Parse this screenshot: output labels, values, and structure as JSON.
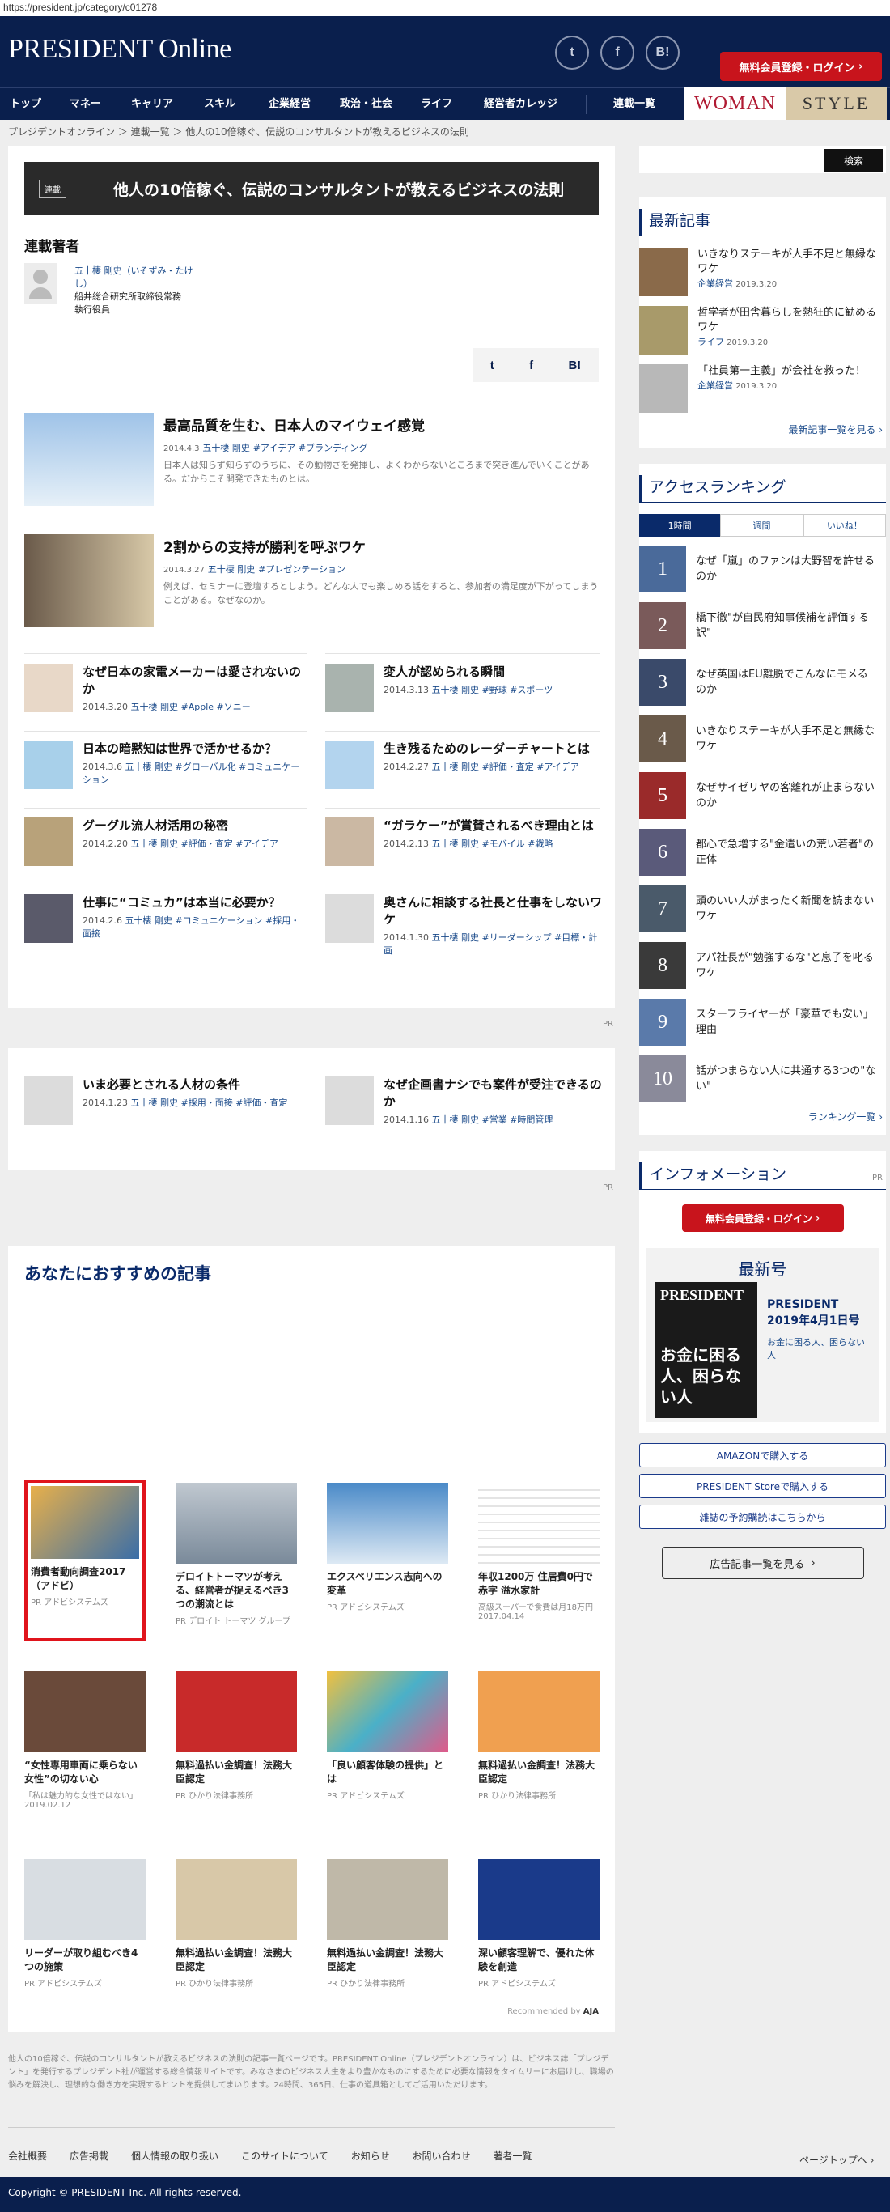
{
  "url": "https://president.jp/category/c01278",
  "logo": "PRESIDENT Online",
  "social": {
    "twitter": "t",
    "facebook": "f",
    "hatena": "B!"
  },
  "register": "無料会員登録・ログイン",
  "nav": [
    "トップ",
    "マネー",
    "キャリア",
    "スキル",
    "企業経営",
    "政治・社会",
    "ライフ",
    "経営者カレッジ",
    "連載一覧"
  ],
  "woman": "WOMAN",
  "style_label": "STYLE",
  "breadcrumb": [
    "プレジデントオンライン",
    "連載一覧",
    "他人の10倍稼ぐ、伝説のコンサルタントが教えるビジネスの法則"
  ],
  "series": {
    "tag": "連載",
    "title": "他人の10倍稼ぐ、伝説のコンサルタントが教えるビジネスの法則"
  },
  "author": {
    "heading": "連載著者",
    "name": "五十棲 剛史（いそずみ・たけし）",
    "org": "船井総合研究所取締役常務",
    "role": "執行役員"
  },
  "featured": [
    {
      "title": "最高品質を生む、日本人のマイウェイ感覚",
      "date": "2014.4.3",
      "author": "五十棲 剛史",
      "tags": "#アイデア #ブランディング",
      "excerpt": "日本人は知らず知らずのうちに、その動物さを発揮し、よくわからないところまで突き進んでいくことがある。だからこそ開発できたものとは。"
    },
    {
      "title": "2割からの支持が勝利を呼ぶワケ",
      "date": "2014.3.27",
      "author": "五十棲 剛史",
      "tags": "#プレゼンテーション",
      "excerpt": "例えば、セミナーに登壇するとしよう。どんな人でも楽しめる話をすると、参加者の満足度が下がってしまうことがある。なぜなのか。"
    }
  ],
  "grid": [
    {
      "title": "なぜ日本の家電メーカーは愛されないのか",
      "date": "2014.3.20",
      "author": "五十棲 剛史",
      "tags": "#Apple #ソニー"
    },
    {
      "title": "変人が認められる瞬間",
      "date": "2014.3.13",
      "author": "五十棲 剛史",
      "tags": "#野球 #スポーツ"
    },
    {
      "title": "日本の暗黙知は世界で活かせるか？",
      "date": "2014.3.6",
      "author": "五十棲 剛史",
      "tags": "#グローバル化 #コミュニケーション"
    },
    {
      "title": "生き残るためのレーダーチャートとは",
      "date": "2014.2.27",
      "author": "五十棲 剛史",
      "tags": "#評価・査定 #アイデア"
    },
    {
      "title": "グーグル流人材活用の秘密",
      "date": "2014.2.20",
      "author": "五十棲 剛史",
      "tags": "#評価・査定 #アイデア"
    },
    {
      "title": "“ガラケー”が賞賛されるべき理由とは",
      "date": "2014.2.13",
      "author": "五十棲 剛史",
      "tags": "#モバイル #戦略"
    },
    {
      "title": "仕事に“コミュカ”は本当に必要か？",
      "date": "2014.2.6",
      "author": "五十棲 剛史",
      "tags": "#コミュニケーション #採用・面接"
    },
    {
      "title": "奥さんに相談する社長と仕事をしないワケ",
      "date": "2014.1.30",
      "author": "五十棲 剛史",
      "tags": "#リーダーシップ #目標・計画"
    }
  ],
  "grid2": [
    {
      "title": "いま必要とされる人材の条件",
      "date": "2014.1.23",
      "author": "五十棲 剛史",
      "tags": "#採用・面接 #評価・査定"
    },
    {
      "title": "なぜ企画書ナシでも案件が受注できるのか",
      "date": "2014.1.16",
      "author": "五十棲 剛史",
      "tags": "#営業 #時間管理"
    }
  ],
  "pr": "PR",
  "recommend": {
    "heading": "あなたにおすすめの記事",
    "items": [
      {
        "t": "消費者動向調査2017（アドビ）",
        "s": "PR アドビシステムズ"
      },
      {
        "t": "デロイトトーマツが考える、経営者が捉えるべき3つの潮流とは",
        "s": "PR デロイト トーマツ グループ"
      },
      {
        "t": "エクスペリエンス志向への変革",
        "s": "PR アドビシステムズ"
      },
      {
        "t": "年収1200万 住居費0円で赤字 溢水家計",
        "s": "高級スーパーで食費は月18万円 2017.04.14"
      },
      {
        "t": "“女性専用車両に乗らない女性”の切ない心",
        "s": "「私は魅力的な女性ではない」 2019.02.12"
      },
      {
        "t": "無料過払い金調査！法務大臣認定",
        "s": "PR ひかり法律事務所"
      },
      {
        "t": "「良い顧客体験の提供」とは",
        "s": "PR アドビシステムズ"
      },
      {
        "t": "無料過払い金調査！法務大臣認定",
        "s": "PR ひかり法律事務所"
      },
      {
        "t": "リーダーが取り組むべき4つの施策",
        "s": "PR アドビシステムズ"
      },
      {
        "t": "無料過払い金調査！法務大臣認定",
        "s": "PR ひかり法律事務所"
      },
      {
        "t": "無料過払い金調査！法務大臣認定",
        "s": "PR ひかり法律事務所"
      },
      {
        "t": "深い顧客理解で、優れた体験を創造",
        "s": "PR アドビシステムズ"
      }
    ],
    "by": "Recommended by",
    "by_brand": "AJA"
  },
  "footer_text": "他人の10倍稼ぐ、伝説のコンサルタントが教えるビジネスの法則の記事一覧ページです。PRESIDENT Online（プレジデントオンライン）は、ビジネス誌「プレジデント」を発行するプレジデント社が運営する総合情報サイトです。みなさまのビジネス人生をより豊かなものにするために必要な情報をタイムリーにお届けし、職場の悩みを解決し、理想的な働き方を実現するヒントを提供してまいります。24時間、365日、仕事の道具箱としてご活用いただけます。",
  "footer_links": [
    "会社概要",
    "広告掲載",
    "個人情報の取り扱い",
    "このサイトについて",
    "お知らせ",
    "お問い合わせ",
    "著者一覧"
  ],
  "pagetop": "ページトップへ",
  "copyright": "Copyright © PRESIDENT Inc. All rights reserved.",
  "sidebar": {
    "search": "検索",
    "latest": {
      "heading": "最新記事",
      "items": [
        {
          "t": "いきなりステーキが人手不足と無縁なワケ",
          "c": "企業経営",
          "d": "2019.3.20"
        },
        {
          "t": "哲学者が田舎暮らしを熱狂的に勧めるワケ",
          "c": "ライフ",
          "d": "2019.3.20"
        },
        {
          "t": "「社員第一主義」が会社を救った！",
          "c": "企業経営",
          "d": "2019.3.20"
        }
      ],
      "more": "最新記事一覧を見る"
    },
    "ranking": {
      "heading": "アクセスランキング",
      "tabs": [
        "1時間",
        "週間",
        "いいね！"
      ],
      "items": [
        "なぜ「嵐」のファンは大野智を許せるのか",
        "橋下徹\"が自民府知事候補を評価する訳\"",
        "なぜ英国はEU離脱でこんなにモメるのか",
        "いきなりステーキが人手不足と無縁なワケ",
        "なぜサイゼリヤの客離れが止まらないのか",
        "都心で急増する\"金遣いの荒い若者\"の正体",
        "頭のいい人がまったく新聞を読まないワケ",
        "アパ社長が\"勉強するな\"と息子を叱るワケ",
        "スターフライヤーが「豪華でも安い」理由",
        "話がつまらない人に共通する3つの\"ない\""
      ],
      "more": "ランキング一覧"
    },
    "info": {
      "heading": "インフォメーション",
      "pr": "PR",
      "register": "無料会員登録・ログイン"
    },
    "issue": {
      "heading": "最新号",
      "magazine": "PRESIDENT",
      "cover_text": "お金に困る人、困らない人",
      "title": "PRESIDENT 2019年4月1日号",
      "sub": "お金に困る人、困らない人",
      "buttons": [
        "AMAZONで購入する",
        "PRESIDENT Storeで購入する",
        "雑誌の予約購読はこちらから"
      ]
    },
    "ad_more": "広告記事一覧を見る"
  }
}
